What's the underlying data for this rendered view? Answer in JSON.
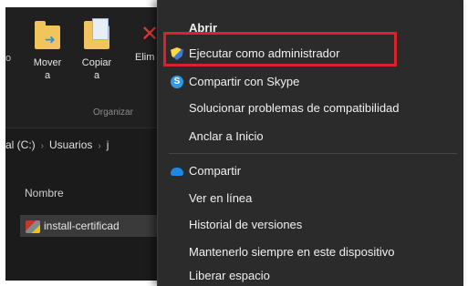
{
  "ribbon": {
    "left_partial": "o",
    "mover_label": "Mover\na",
    "copiar_label": "Copiar\na",
    "elim_label": "Elim",
    "group_label": "Organizar"
  },
  "address": {
    "drive": "al (C:)",
    "folder": "Usuarios",
    "next": "j"
  },
  "list": {
    "column_name": "Nombre",
    "file_name": "install-certificad"
  },
  "context_menu": {
    "items": [
      {
        "label": "Abrir",
        "icon": "none"
      },
      {
        "label": "Ejecutar como administrador",
        "icon": "uac-shield-icon"
      },
      {
        "label": "Compartir con Skype",
        "icon": "skype-icon"
      },
      {
        "label": "Solucionar problemas de compatibilidad",
        "icon": "none"
      },
      {
        "label": "Anclar a Inicio",
        "icon": "none"
      },
      {
        "label": "Compartir",
        "icon": "onedrive-cloud-icon"
      },
      {
        "label": "Ver en línea",
        "icon": "none"
      },
      {
        "label": "Historial de versiones",
        "icon": "none"
      },
      {
        "label": "Mantenerlo siempre en este dispositivo",
        "icon": "none"
      },
      {
        "label": "Liberar espacio",
        "icon": "none"
      }
    ]
  },
  "colors": {
    "highlight_border": "#d9232a",
    "menu_bg": "#2b2b2b",
    "window_bg": "#1b1b1b"
  }
}
